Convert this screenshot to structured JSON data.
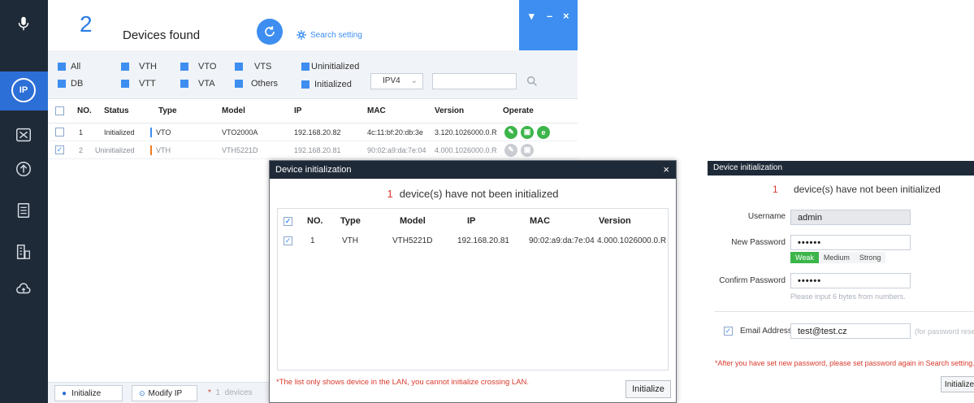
{
  "app": {
    "found_count": "2",
    "found_label": "Devices found",
    "search_setting": "Search setting",
    "window_controls": {
      "menu": "▾",
      "minimize": "–",
      "close": "×"
    },
    "sidebar_icons": [
      "microphone-icon",
      "ip-icon",
      "tools-icon",
      "upgrade-icon",
      "document-icon",
      "building-icon",
      "cloud-icon"
    ],
    "sidebar_active_label": "IP"
  },
  "filters": {
    "all": "All",
    "db": "DB",
    "vth": "VTH",
    "vtt": "VTT",
    "vto": "VTO",
    "vta": "VTA",
    "vts": "VTS",
    "others": "Others",
    "uninitialized": "Uninitialized",
    "initialized": "Initialized",
    "ip_version": "IPV4"
  },
  "grid": {
    "headers": [
      "NO.",
      "Status",
      "Type",
      "Model",
      "IP",
      "MAC",
      "Version",
      "Operate"
    ],
    "rows": [
      {
        "no": "1",
        "status": "Initialized",
        "type": "VTO",
        "type_color": "#3d8ef0",
        "model": "VTO2000A",
        "ip": "192.168.20.82",
        "mac": "4c:11:bf:20:db:3e",
        "version": "3.120.1026000.0.R",
        "checked": false
      },
      {
        "no": "2",
        "status": "Uninitialized",
        "type": "VTH",
        "type_color": "#f07c22",
        "model": "VTH5221D",
        "ip": "192.168.20.81",
        "mac": "90:02:a9:da:7e:04",
        "version": "4.000.1026000.0.R",
        "checked": true
      }
    ]
  },
  "bottombar": {
    "initialize": "Initialize",
    "modify_ip": "Modify IP",
    "star": "*",
    "count": "1",
    "devices": "devices"
  },
  "dialog": {
    "title": "Device initialization",
    "count": "1",
    "message": "device(s) have not been initialized",
    "headers": [
      "NO.",
      "Type",
      "Model",
      "IP",
      "MAC",
      "Version"
    ],
    "rows": [
      {
        "no": "1",
        "type": "VTH",
        "model": "VTH5221D",
        "ip": "192.168.20.81",
        "mac": "90:02:a9:da:7e:04",
        "version": "4.000.1026000.0.R"
      }
    ],
    "note": "*The list only shows device in the LAN, you cannot initialize crossing LAN.",
    "button": "Initialize",
    "close": "×"
  },
  "right_dialog": {
    "title": "Device initialization",
    "count": "1",
    "message": "device(s) have not been initialized",
    "username_label": "Username",
    "username_value": "admin",
    "new_password_label": "New Password",
    "new_password_value": "••••••",
    "strength_weak": "Weak",
    "strength_medium": "Medium",
    "strength_strong": "Strong",
    "confirm_label": "Confirm Password",
    "confirm_value": "••••••",
    "hint": "Please input 6 bytes from numbers.",
    "email_label": "Email Address",
    "email_value": "test@test.cz",
    "email_hint": "(for password reset)",
    "note": "*After you have set new password, please set password again in Search setting.",
    "button": "Initialize"
  },
  "colors": {
    "accent": "#3d8ef0",
    "sidebar": "#1f2a38",
    "warn": "#d83a2d",
    "weak": "#3cb54a"
  }
}
